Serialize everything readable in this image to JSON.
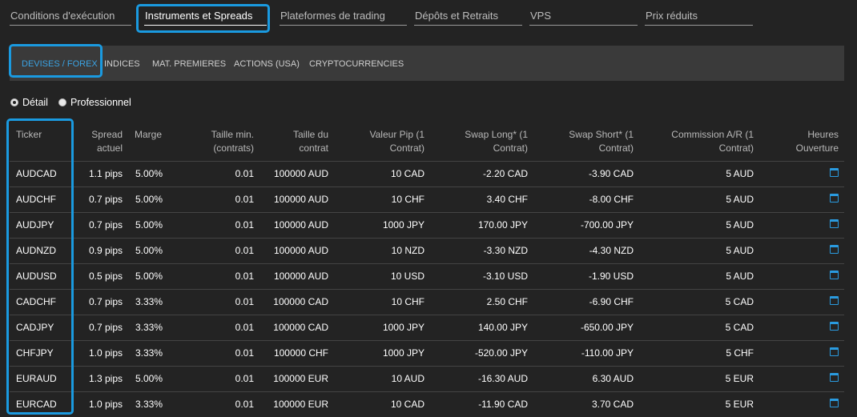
{
  "top_tabs": [
    {
      "label": "Conditions d'exécution",
      "active": false
    },
    {
      "label": "Instruments et Spreads",
      "active": true
    },
    {
      "label": "Plateformes de trading",
      "active": false
    },
    {
      "label": "Dépôts et Retraits",
      "active": false
    },
    {
      "label": "VPS",
      "active": false
    },
    {
      "label": "Prix réduits",
      "active": false
    }
  ],
  "sub_tabs": [
    {
      "label": "DEVISES / FOREX",
      "active": true
    },
    {
      "label": "INDICES",
      "active": false
    },
    {
      "label": "MAT. PREMIERES",
      "active": false
    },
    {
      "label": "ACTIONS (USA)",
      "active": false
    },
    {
      "label": "CRYPTOCURRENCIES",
      "active": false
    }
  ],
  "account_types": [
    {
      "label": "Détail",
      "selected": true
    },
    {
      "label": "Professionnel",
      "selected": false
    }
  ],
  "columns": [
    {
      "line1": "Ticker",
      "line2": ""
    },
    {
      "line1": "Spread",
      "line2": "actuel"
    },
    {
      "line1": "Marge",
      "line2": ""
    },
    {
      "line1": "Taille min.",
      "line2": "(contrats)"
    },
    {
      "line1": "Taille du",
      "line2": "contrat"
    },
    {
      "line1": "Valeur Pip (1",
      "line2": "Contrat)"
    },
    {
      "line1": "Swap Long* (1",
      "line2": "Contrat)"
    },
    {
      "line1": "Swap Short* (1",
      "line2": "Contrat)"
    },
    {
      "line1": "Commission A/R (1",
      "line2": "Contrat)"
    },
    {
      "line1": "Heures",
      "line2": "Ouverture"
    }
  ],
  "rows": [
    {
      "ticker": "AUDCAD",
      "spread": "1.1 pips",
      "margin": "5.00%",
      "min_size": "0.01",
      "contract": "100000 AUD",
      "pip": "10 CAD",
      "swap_long": "-2.20 CAD",
      "swap_short": "-3.90 CAD",
      "commission": "5 AUD"
    },
    {
      "ticker": "AUDCHF",
      "spread": "0.7 pips",
      "margin": "5.00%",
      "min_size": "0.01",
      "contract": "100000 AUD",
      "pip": "10 CHF",
      "swap_long": "3.40 CHF",
      "swap_short": "-8.00 CHF",
      "commission": "5 AUD"
    },
    {
      "ticker": "AUDJPY",
      "spread": "0.7 pips",
      "margin": "5.00%",
      "min_size": "0.01",
      "contract": "100000 AUD",
      "pip": "1000 JPY",
      "swap_long": "170.00 JPY",
      "swap_short": "-700.00 JPY",
      "commission": "5 AUD"
    },
    {
      "ticker": "AUDNZD",
      "spread": "0.9 pips",
      "margin": "5.00%",
      "min_size": "0.01",
      "contract": "100000 AUD",
      "pip": "10 NZD",
      "swap_long": "-3.30 NZD",
      "swap_short": "-4.30 NZD",
      "commission": "5 AUD"
    },
    {
      "ticker": "AUDUSD",
      "spread": "0.5 pips",
      "margin": "5.00%",
      "min_size": "0.01",
      "contract": "100000 AUD",
      "pip": "10 USD",
      "swap_long": "-3.10 USD",
      "swap_short": "-1.90 USD",
      "commission": "5 AUD"
    },
    {
      "ticker": "CADCHF",
      "spread": "0.7 pips",
      "margin": "3.33%",
      "min_size": "0.01",
      "contract": "100000 CAD",
      "pip": "10 CHF",
      "swap_long": "2.50 CHF",
      "swap_short": "-6.90 CHF",
      "commission": "5 CAD"
    },
    {
      "ticker": "CADJPY",
      "spread": "0.7 pips",
      "margin": "3.33%",
      "min_size": "0.01",
      "contract": "100000 CAD",
      "pip": "1000 JPY",
      "swap_long": "140.00 JPY",
      "swap_short": "-650.00 JPY",
      "commission": "5 CAD"
    },
    {
      "ticker": "CHFJPY",
      "spread": "1.0 pips",
      "margin": "3.33%",
      "min_size": "0.01",
      "contract": "100000 CHF",
      "pip": "1000 JPY",
      "swap_long": "-520.00 JPY",
      "swap_short": "-110.00 JPY",
      "commission": "5 CHF"
    },
    {
      "ticker": "EURAUD",
      "spread": "1.3 pips",
      "margin": "5.00%",
      "min_size": "0.01",
      "contract": "100000 EUR",
      "pip": "10 AUD",
      "swap_long": "-16.30 AUD",
      "swap_short": "6.30 AUD",
      "commission": "5 EUR"
    },
    {
      "ticker": "EURCAD",
      "spread": "1.0 pips",
      "margin": "3.33%",
      "min_size": "0.01",
      "contract": "100000 EUR",
      "pip": "10 CAD",
      "swap_long": "-11.90 CAD",
      "swap_short": "3.70 CAD",
      "commission": "5 EUR"
    }
  ],
  "icons": {
    "hours": "calendar-icon"
  },
  "colors": {
    "accent": "#1a9ae0",
    "background": "#232323",
    "subnav": "#3a3a3a"
  }
}
